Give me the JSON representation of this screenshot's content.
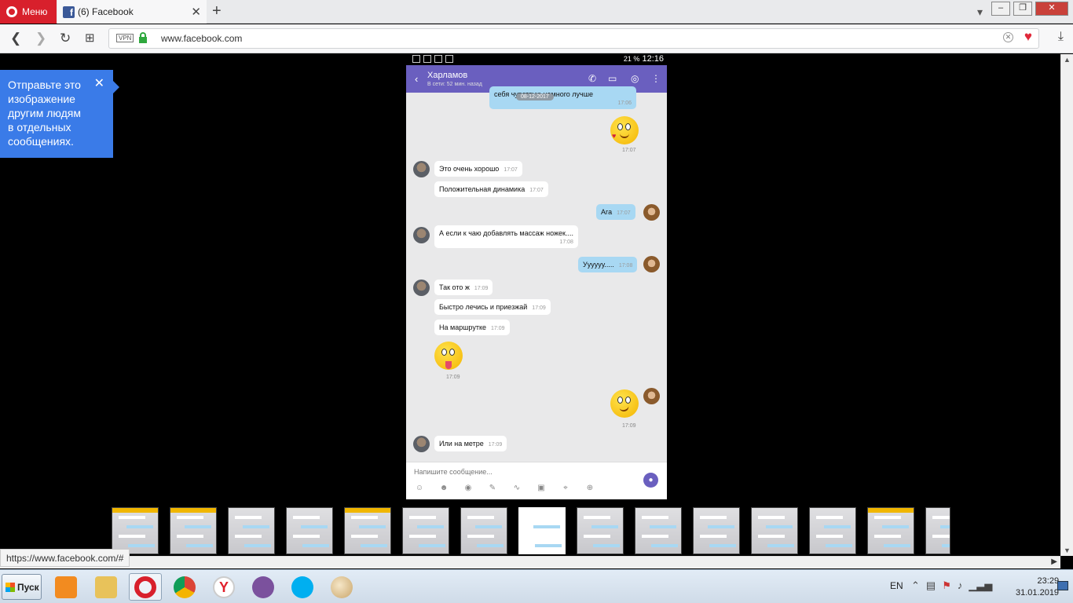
{
  "browser": {
    "menu_label": "Меню",
    "tab_title": "(6) Facebook",
    "vpn_label": "VPN",
    "url_host": "www.facebook.com",
    "status_url": "https://www.facebook.com/#",
    "accent": "#d8202c"
  },
  "tooltip": {
    "text": "Отправьте это изображение другим людям в отдельных сообщениях."
  },
  "phone": {
    "status": {
      "battery": "21 %",
      "time": "12:16"
    },
    "chat": {
      "contact_name": "Харламов",
      "contact_status": "В сети: 52 мин. назад",
      "date_pill": "08-12-2017",
      "header_color": "#6a5fbf",
      "messages": [
        {
          "dir": "out",
          "text": "себя чувствую немного лучше",
          "time": "17:06"
        },
        {
          "dir": "out",
          "type": "sticker",
          "sticker": "kiss-emoji",
          "time": "17:07"
        },
        {
          "dir": "in",
          "text": "Это очень хорошо",
          "time": "17:07"
        },
        {
          "dir": "in",
          "text": "Положительная динамика",
          "time": "17:07"
        },
        {
          "dir": "out",
          "text": "Ага",
          "time": "17:07"
        },
        {
          "dir": "in",
          "text": "А если к чаю добавлять массаж ножек....",
          "time": "17:08"
        },
        {
          "dir": "out",
          "text": "Уууууу.....",
          "time": "17:08"
        },
        {
          "dir": "in",
          "text": "Так ото ж",
          "time": "17:09"
        },
        {
          "dir": "in",
          "text": "Быстро лечись и приезжай",
          "time": "17:09"
        },
        {
          "dir": "in",
          "text": "На маршрутке",
          "time": "17:09"
        },
        {
          "dir": "in",
          "type": "sticker",
          "sticker": "tongue-emoji",
          "time": "17:09"
        },
        {
          "dir": "out",
          "type": "sticker",
          "sticker": "confused-emoji",
          "time": "17:09"
        },
        {
          "dir": "in",
          "text": "Или на метре",
          "time": "17:09"
        }
      ],
      "input_placeholder": "Напишите сообщение..."
    }
  },
  "thumbnails": {
    "count": 15,
    "selected_index": 7
  },
  "taskbar": {
    "start_label": "Пуск",
    "apps": [
      "media-player-icon",
      "file-explorer-icon",
      "opera-icon",
      "chrome-icon",
      "yandex-browser-icon",
      "viber-icon",
      "skype-icon",
      "paint-icon"
    ],
    "language": "EN",
    "clock_time": "23:29",
    "clock_date": "31.01.2019"
  }
}
